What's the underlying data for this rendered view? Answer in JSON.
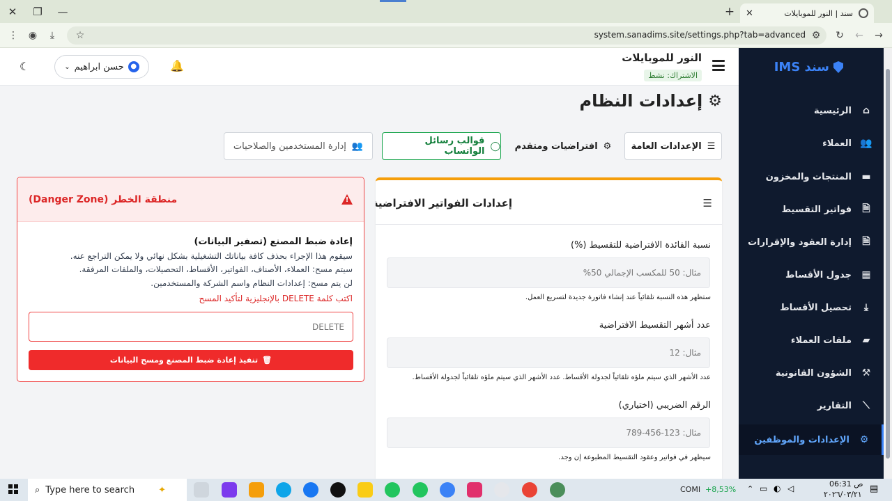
{
  "browser": {
    "tab_title": "سند | النور للموبايلات",
    "url": "system.sanadims.site/settings.php?tab=advanced"
  },
  "sidebar": {
    "brand": "سند IMS",
    "items": [
      {
        "label": "الرئيسية",
        "icon": "home-icon",
        "glyph": "⌂"
      },
      {
        "label": "العملاء",
        "icon": "users-icon",
        "glyph": "👥"
      },
      {
        "label": "المنتجات والمخزون",
        "icon": "box-icon",
        "glyph": "▬"
      },
      {
        "label": "فواتير التقسيط",
        "icon": "file-invoice-icon",
        "glyph": "🗎"
      },
      {
        "label": "إدارة العقود والإقرارات",
        "icon": "file-contract-icon",
        "glyph": "🗎"
      },
      {
        "label": "جدول الأقساط",
        "icon": "calendar-icon",
        "glyph": "▦"
      },
      {
        "label": "تحصيل الأقساط",
        "icon": "hand-money-icon",
        "glyph": "⤓"
      },
      {
        "label": "ملفات العملاء",
        "icon": "folder-icon",
        "glyph": "▰"
      },
      {
        "label": "الشؤون القانونية",
        "icon": "gavel-icon",
        "glyph": "⚒"
      },
      {
        "label": "التقارير",
        "icon": "chart-icon",
        "glyph": "⟋"
      },
      {
        "label": "الإعدادات والموظفين",
        "icon": "gear-icon",
        "glyph": "⚙"
      }
    ]
  },
  "header": {
    "shop_name": "النور للموبايلات",
    "subscription": "الاشتراك: نشط",
    "user_name": "حسن ابراهيم"
  },
  "page": {
    "title": "إعدادات النظام"
  },
  "tabs": [
    {
      "label": "الإعدادات العامة"
    },
    {
      "label": "افتراضيات ومتقدم"
    },
    {
      "label": "قوالب رسائل الواتساب"
    },
    {
      "label": "إدارة المستخدمين والصلاحيات"
    }
  ],
  "invoice_settings": {
    "title": "إعدادات الفواتير الافتراضية",
    "fields": [
      {
        "label": "نسبة الفائدة الافتراضية للتقسيط (%)",
        "placeholder": "مثال: 50 للمكسب الإجمالي 50%",
        "help": "ستظهر هذه النسبة تلقائياً عند إنشاء فاتورة جديدة لتسريع العمل."
      },
      {
        "label": "عدد أشهر التقسيط الافتراضية",
        "placeholder": "مثال: 12",
        "help": "عدد الأشهر الذي سيتم ملؤه تلقائياً لجدولة الأقساط. عدد الأشهر الذي سيتم ملؤه تلقائياً لجدولة الأقساط."
      },
      {
        "label": "الرقم الضريبي (اختياري)",
        "placeholder": "مثال: 123-456-789",
        "help": "سيظهر في فواتير وعقود التقسيط المطبوعة إن وجد."
      }
    ]
  },
  "danger": {
    "title": "منطقة الخطر (Danger Zone)",
    "reset_title": "إعادة ضبط المصنع (تصفير البيانات)",
    "line1": "سيقوم هذا الإجراء بحذف كافة بياناتك التشغيلية بشكل نهائي ولا يمكن التراجع عنه.",
    "line2": "سيتم مسح: العملاء، الأصناف، الفواتير، الأقساط، التحصيلات، والملفات المرفقة.",
    "line3": "لن يتم مسح: إعدادات النظام واسم الشركة والمستخدمين.",
    "confirm": "اكتب كلمة DELETE بالإنجليزية لتأكيد المسح",
    "input_placeholder": "DELETE",
    "button": "تنفيذ إعادة ضبط المصنع ومسح البيانات"
  },
  "taskbar": {
    "search_placeholder": "Type here to search",
    "ticker": "COMI",
    "ticker_change": "+8,53%",
    "time": "06:31 ص",
    "date": "٢٠٢٦/٠٣/٢١"
  }
}
